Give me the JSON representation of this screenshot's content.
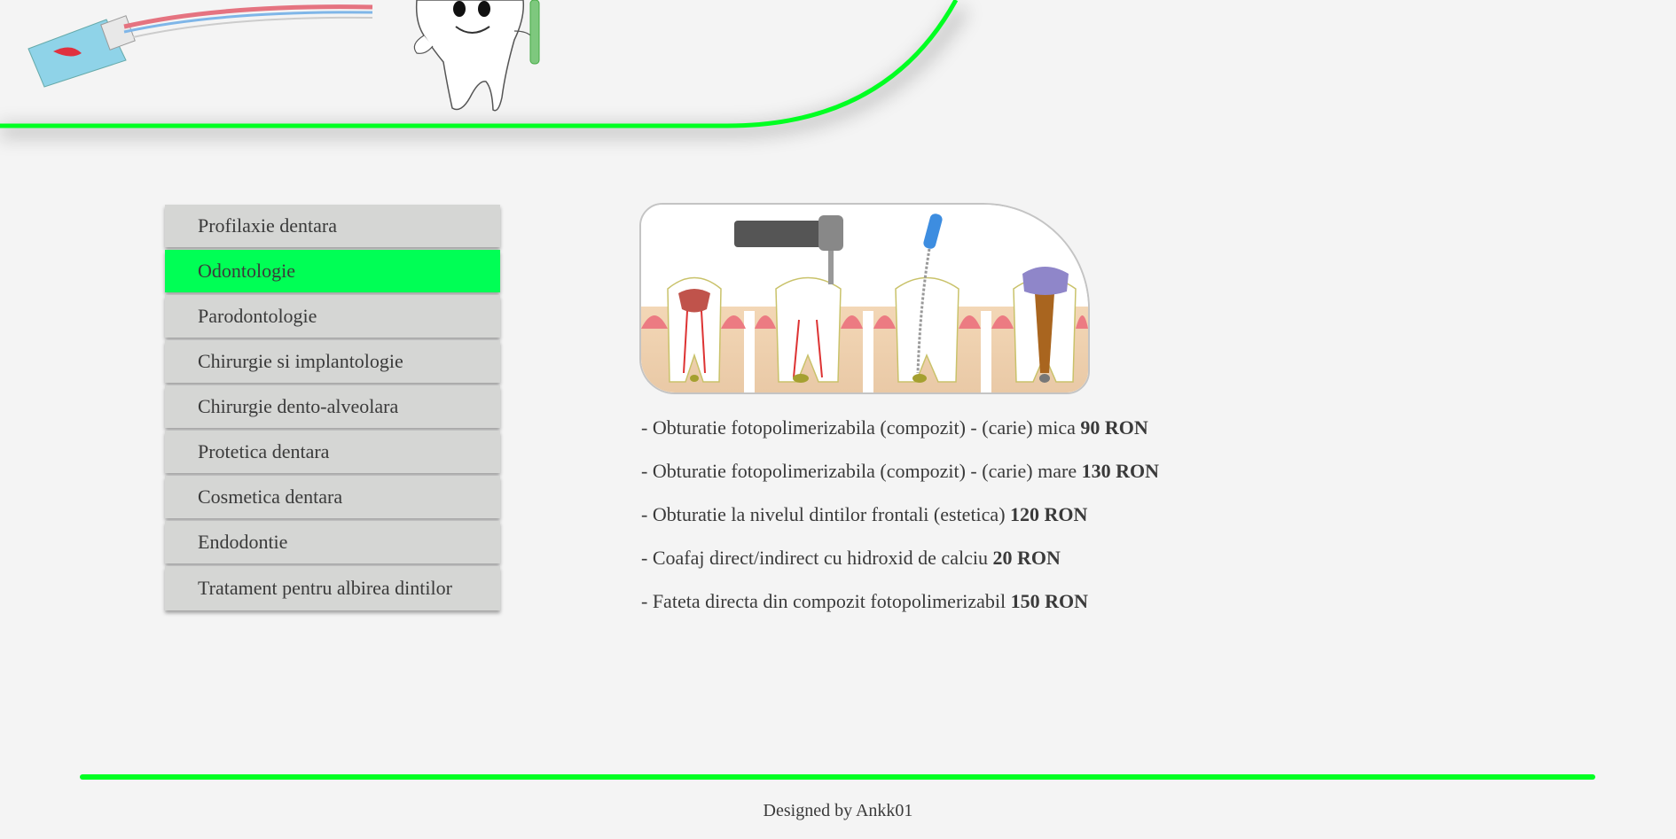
{
  "menu": {
    "items": [
      {
        "label": "Profilaxie dentara"
      },
      {
        "label": "Odontologie"
      },
      {
        "label": "Parodontologie"
      },
      {
        "label": "Chirurgie si implantologie"
      },
      {
        "label": "Chirurgie dento-alveolara"
      },
      {
        "label": "Protetica dentara"
      },
      {
        "label": "Cosmetica dentara"
      },
      {
        "label": "Endodontie"
      },
      {
        "label": "Tratament pentru albirea dintilor"
      }
    ],
    "active_index": 1
  },
  "prices": [
    {
      "text": "- Obturatie fotopolimerizabila (compozit) - (carie) mica ",
      "price": "90 RON"
    },
    {
      "text": "- Obturatie fotopolimerizabila (compozit) - (carie) mare ",
      "price": "130 RON"
    },
    {
      "text": "- Obturatie la nivelul dintilor frontali (estetica) ",
      "price": "120 RON"
    },
    {
      "text": "- Coafaj direct/indirect cu hidroxid de calciu ",
      "price": "20 RON"
    },
    {
      "text": "- Fateta directa din compozit fotopolimerizabil ",
      "price": "150 RON"
    }
  ],
  "footer": {
    "text": "Designed by Ankk01"
  },
  "colors": {
    "accent": "#00ff22",
    "menu_bg": "#d5d6d4",
    "active_bg": "#00ff55",
    "page_bg": "#f4f4f4"
  },
  "icons": [
    "toothpaste-icon",
    "tooth-mascot-icon",
    "dental-procedure-illustration"
  ]
}
